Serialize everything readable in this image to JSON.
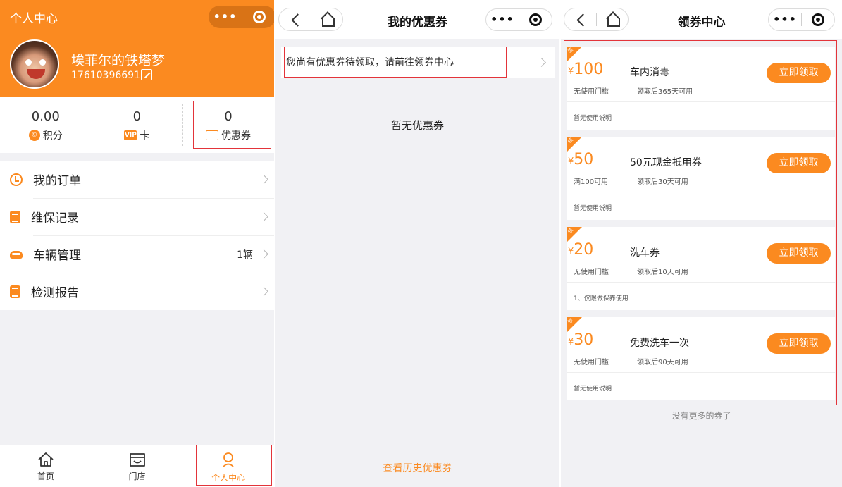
{
  "colors": {
    "accent": "#fb8a20",
    "highlight_box": "#e3343a",
    "page_bg": "#f1f1f4"
  },
  "profile_screen": {
    "header_title": "个人中心",
    "capsule_more": "•••",
    "user": {
      "name": "埃菲尔的铁塔梦",
      "phone": "17610396691",
      "edit_icon": "edit-icon"
    },
    "stats": [
      {
        "value": "0.00",
        "label": "积分",
        "icon": "points-icon",
        "icon_glyph": "©"
      },
      {
        "value": "0",
        "label": "卡",
        "icon": "vip-card-icon",
        "icon_glyph": "VIP"
      },
      {
        "value": "0",
        "label": "优惠券",
        "icon": "coupon-icon",
        "icon_glyph": ""
      }
    ],
    "menu": [
      {
        "label": "我的订单",
        "icon": "clock-icon",
        "extra": ""
      },
      {
        "label": "维保记录",
        "icon": "document-icon",
        "extra": ""
      },
      {
        "label": "车辆管理",
        "icon": "car-icon",
        "extra": "1辆"
      },
      {
        "label": "检测报告",
        "icon": "report-icon",
        "extra": ""
      }
    ],
    "tabbar": [
      {
        "label": "首页",
        "icon": "home-icon",
        "active": false
      },
      {
        "label": "门店",
        "icon": "store-icon",
        "active": false
      },
      {
        "label": "个人中心",
        "icon": "user-icon",
        "active": true
      }
    ]
  },
  "my_coupons_screen": {
    "title": "我的优惠券",
    "capsule_more": "•••",
    "notice": "您尚有优惠券待领取，请前往领券中心",
    "empty_text": "暂无优惠券",
    "history_link": "查看历史优惠券"
  },
  "coupon_center_screen": {
    "title": "领券中心",
    "capsule_more": "•••",
    "corner_tag": "领",
    "currency": "¥",
    "coupons": [
      {
        "amount": "100",
        "name": "车内消毒",
        "condition": "无使用门槛",
        "validity": "领取后365天可用",
        "button": "立即领取",
        "note": "暂无使用说明"
      },
      {
        "amount": "50",
        "name": "50元现金抵用券",
        "condition": "满100可用",
        "validity": "领取后30天可用",
        "button": "立即领取",
        "note": "暂无使用说明"
      },
      {
        "amount": "20",
        "name": "洗车券",
        "condition": "无使用门槛",
        "validity": "领取后10天可用",
        "button": "立即领取",
        "note": "1、仅限做保养使用"
      },
      {
        "amount": "30",
        "name": "免费洗车一次",
        "condition": "无使用门槛",
        "validity": "领取后90天可用",
        "button": "立即领取",
        "note": "暂无使用说明"
      }
    ],
    "footer": "没有更多的券了"
  }
}
